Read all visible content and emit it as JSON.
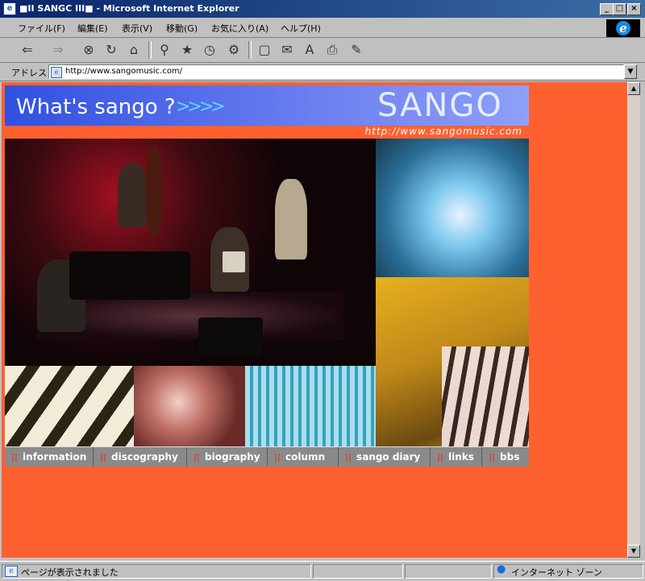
{
  "window": {
    "title": "■II  SANGC  III■ - Microsoft Internet Explorer",
    "minimize_label": "_",
    "maximize_label": "□",
    "close_label": "×"
  },
  "menu": {
    "items": [
      {
        "label": "ファイル(F)"
      },
      {
        "label": "編集(E)"
      },
      {
        "label": "表示(V)"
      },
      {
        "label": "移動(G)"
      },
      {
        "label": "お気に入り(A)"
      },
      {
        "label": "ヘルプ(H)"
      }
    ]
  },
  "toolbar": {
    "icons": [
      "back-icon",
      "forward-icon",
      "stop-icon",
      "refresh-icon",
      "home-icon",
      "search-icon",
      "favorites-icon",
      "history-icon",
      "channels-icon",
      "fullscreen-icon",
      "mail-icon",
      "font-icon",
      "print-icon",
      "edit-icon"
    ]
  },
  "address": {
    "label": "アドレス",
    "url": "http://www.sangomusic.com/"
  },
  "page": {
    "header_tagline": "What's sango ?",
    "header_arrows": ">>>>",
    "logo": "SANGO",
    "site_url": "http://www.sangomusic.com",
    "nav": [
      {
        "label": "information"
      },
      {
        "label": "discography"
      },
      {
        "label": "biography"
      },
      {
        "label": "column"
      },
      {
        "label": "sango diary"
      },
      {
        "label": "links"
      },
      {
        "label": "bbs"
      }
    ],
    "nav_marker": "||",
    "background_color": "#ff6030",
    "header_color": "#3050e0"
  },
  "status": {
    "text": "ページが表示されました",
    "zone": "インターネット ゾーン"
  }
}
